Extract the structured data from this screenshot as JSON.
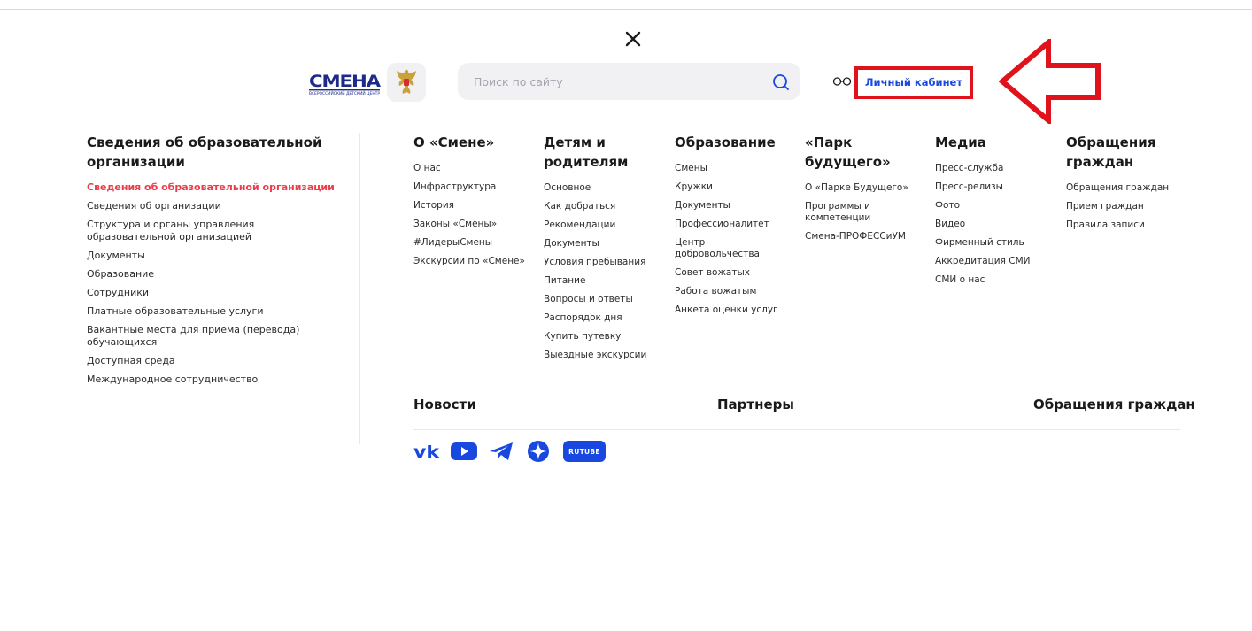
{
  "header": {
    "close_icon": "close-icon",
    "logo_text": "СМЕНА",
    "logo_subtext": "ВСЕРОССИЙСКИЙ ДЕТСКИЙ ЦЕНТР",
    "search": {
      "placeholder": "Поиск по сайту",
      "value": ""
    },
    "accessibility_icon": "glasses-icon",
    "cabinet_label": "Личный кабинет",
    "highlight_color": "#e0121b",
    "accent_color": "#1848e0"
  },
  "left": {
    "title": "Сведения об образовательной организации",
    "items": [
      "Сведения об образовательной организации",
      "Сведения об организации",
      "Структура и органы управления образовательной организацией",
      "Документы",
      "Образование",
      "Сотрудники",
      "Платные образовательные услуги",
      "Вакантные места для приема (перевода) обучающихся",
      "Доступная среда",
      "Международное сотрудничество"
    ]
  },
  "columns": [
    {
      "title": "О «Смене»",
      "items": [
        "О нас",
        "Инфраструктура",
        "История",
        "Законы «Смены»",
        "#ЛидерыСмены",
        "Экскурсии по «Смене»"
      ]
    },
    {
      "title": "Детям и родителям",
      "items": [
        "Основное",
        "Как добраться",
        "Рекомендации",
        "Документы",
        "Условия пребывания",
        "Питание",
        "Вопросы и ответы",
        "Распорядок дня",
        "Купить путевку",
        "Выездные экскурсии"
      ]
    },
    {
      "title": "Образование",
      "items": [
        "Смены",
        "Кружки",
        "Документы",
        "Профессионалитет",
        "Центр добровольчества",
        "Совет вожатых",
        "Работа вожатым",
        "Анкета оценки услуг"
      ]
    },
    {
      "title": "«Парк будущего»",
      "items": [
        "О «Парке Будущего»",
        "Программы и компетенции",
        "Смена-ПРОФЕССиУМ"
      ]
    },
    {
      "title": "Медиа",
      "items": [
        "Пресс-служба",
        "Пресс-релизы",
        "Фото",
        "Видео",
        "Фирменный стиль",
        "Аккредитация СМИ",
        "СМИ о нас"
      ]
    },
    {
      "title": "Обращения граждан",
      "items": [
        "Обращения граждан",
        "Прием граждан",
        "Правила записи"
      ]
    }
  ],
  "bottom": {
    "news": "Новости",
    "partners": "Партнеры",
    "appeals": "Обращения граждан"
  },
  "social": {
    "icons": [
      "vk-icon",
      "youtube-icon",
      "telegram-icon",
      "dzen-icon",
      "rutube-icon"
    ],
    "rutube_label": "RUTUBE"
  }
}
